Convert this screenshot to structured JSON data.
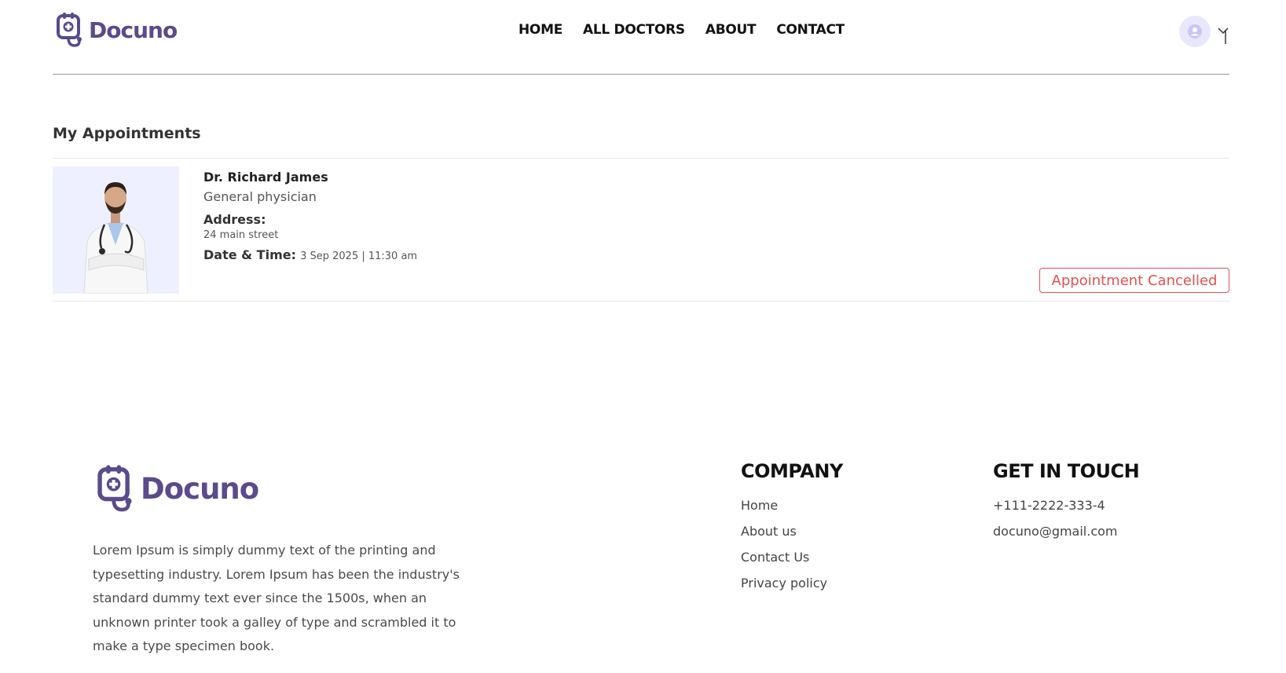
{
  "brand": {
    "name": "Docuno",
    "color": "#5b4a8c"
  },
  "nav": {
    "items": [
      "HOME",
      "ALL DOCTORS",
      "ABOUT",
      "CONTACT"
    ]
  },
  "page": {
    "title": "My Appointments"
  },
  "appointment": {
    "doctor_name": "Dr. Richard James",
    "speciality": "General physician",
    "address_label": "Address:",
    "address_line": "24 main street",
    "datetime_label": "Date & Time:",
    "datetime_value": "3 Sep 2025 | 11:30 am",
    "status": "Appointment Cancelled",
    "status_color": "#e05252"
  },
  "footer": {
    "description": "Lorem Ipsum is simply dummy text of the printing and typesetting industry. Lorem Ipsum has been the industry's standard dummy text ever since the 1500s, when an unknown printer took a galley of type and scrambled it to make a type specimen book.",
    "company": {
      "title": "COMPANY",
      "links": [
        "Home",
        "About us",
        "Contact Us",
        "Privacy policy"
      ]
    },
    "contact": {
      "title": "GET IN TOUCH",
      "phone": "+111-2222-333-4",
      "email": "docuno@gmail.com"
    }
  }
}
